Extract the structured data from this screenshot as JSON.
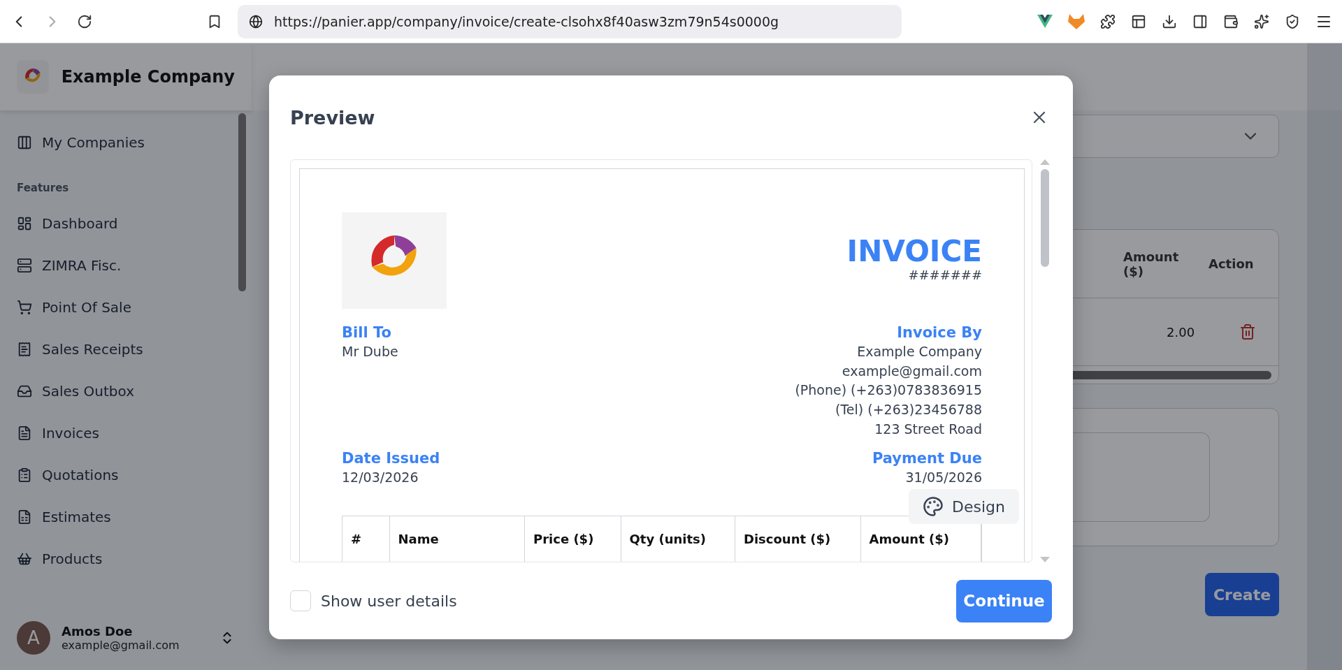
{
  "browser": {
    "url": "https://panier.app/company/invoice/create-clsohx8f40asw3zm79n54s0000g"
  },
  "sidebar": {
    "company_name": "Example Company",
    "top_items": [
      {
        "label": "My Companies"
      }
    ],
    "section_label": "Features",
    "items": [
      {
        "label": "Dashboard"
      },
      {
        "label": "ZIMRA Fisc."
      },
      {
        "label": "Point Of Sale"
      },
      {
        "label": "Sales Receipts"
      },
      {
        "label": "Sales Outbox"
      },
      {
        "label": "Invoices"
      },
      {
        "label": "Quotations"
      },
      {
        "label": "Estimates"
      },
      {
        "label": "Products"
      }
    ],
    "user": {
      "initial": "A",
      "name": "Amos Doe",
      "email": "example@gmail.com"
    }
  },
  "background": {
    "table_columns": [
      "Amount ($)",
      "Action"
    ],
    "row_amount": "2.00",
    "create_button": "Create"
  },
  "dialog": {
    "title": "Preview",
    "invoice": {
      "title": "INVOICE",
      "number": "#######",
      "bill_to_label": "Bill To",
      "bill_to": "Mr Dube",
      "invoice_by_label": "Invoice By",
      "invoice_by_lines": [
        "Example Company",
        "example@gmail.com",
        "(Phone) (+263)0783836915",
        "(Tel) (+263)23456788",
        "123 Street Road"
      ],
      "date_issued_label": "Date Issued",
      "date_issued": "12/03/2026",
      "payment_due_label": "Payment Due",
      "payment_due": "31/05/2026",
      "columns": [
        "#",
        "Name",
        "Price ($)",
        "Qty (units)",
        "Discount ($)",
        "Amount ($)"
      ]
    },
    "design_button": "Design",
    "show_user_details": {
      "label": "Show user details",
      "checked": false
    },
    "continue_button": "Continue"
  }
}
